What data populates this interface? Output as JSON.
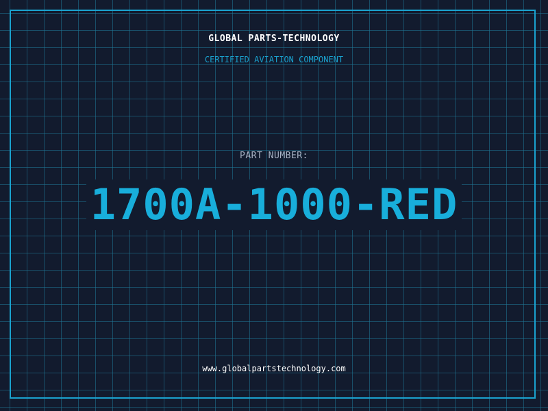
{
  "brand": {
    "name": "GLOBAL PARTS-TECHNOLOGY",
    "tagline": "CERTIFIED AVIATION COMPONENT"
  },
  "part": {
    "label": "PART NUMBER:",
    "number": "1700A-1000-RED"
  },
  "footer": {
    "url": "www.globalpartstechnology.com"
  },
  "colors": {
    "background": "#121b2e",
    "grid": "#1f7896",
    "accent": "#1aa2cf",
    "part_number": "#18aedb",
    "text_primary": "#ffffff",
    "text_muted": "#a9b4c6"
  }
}
